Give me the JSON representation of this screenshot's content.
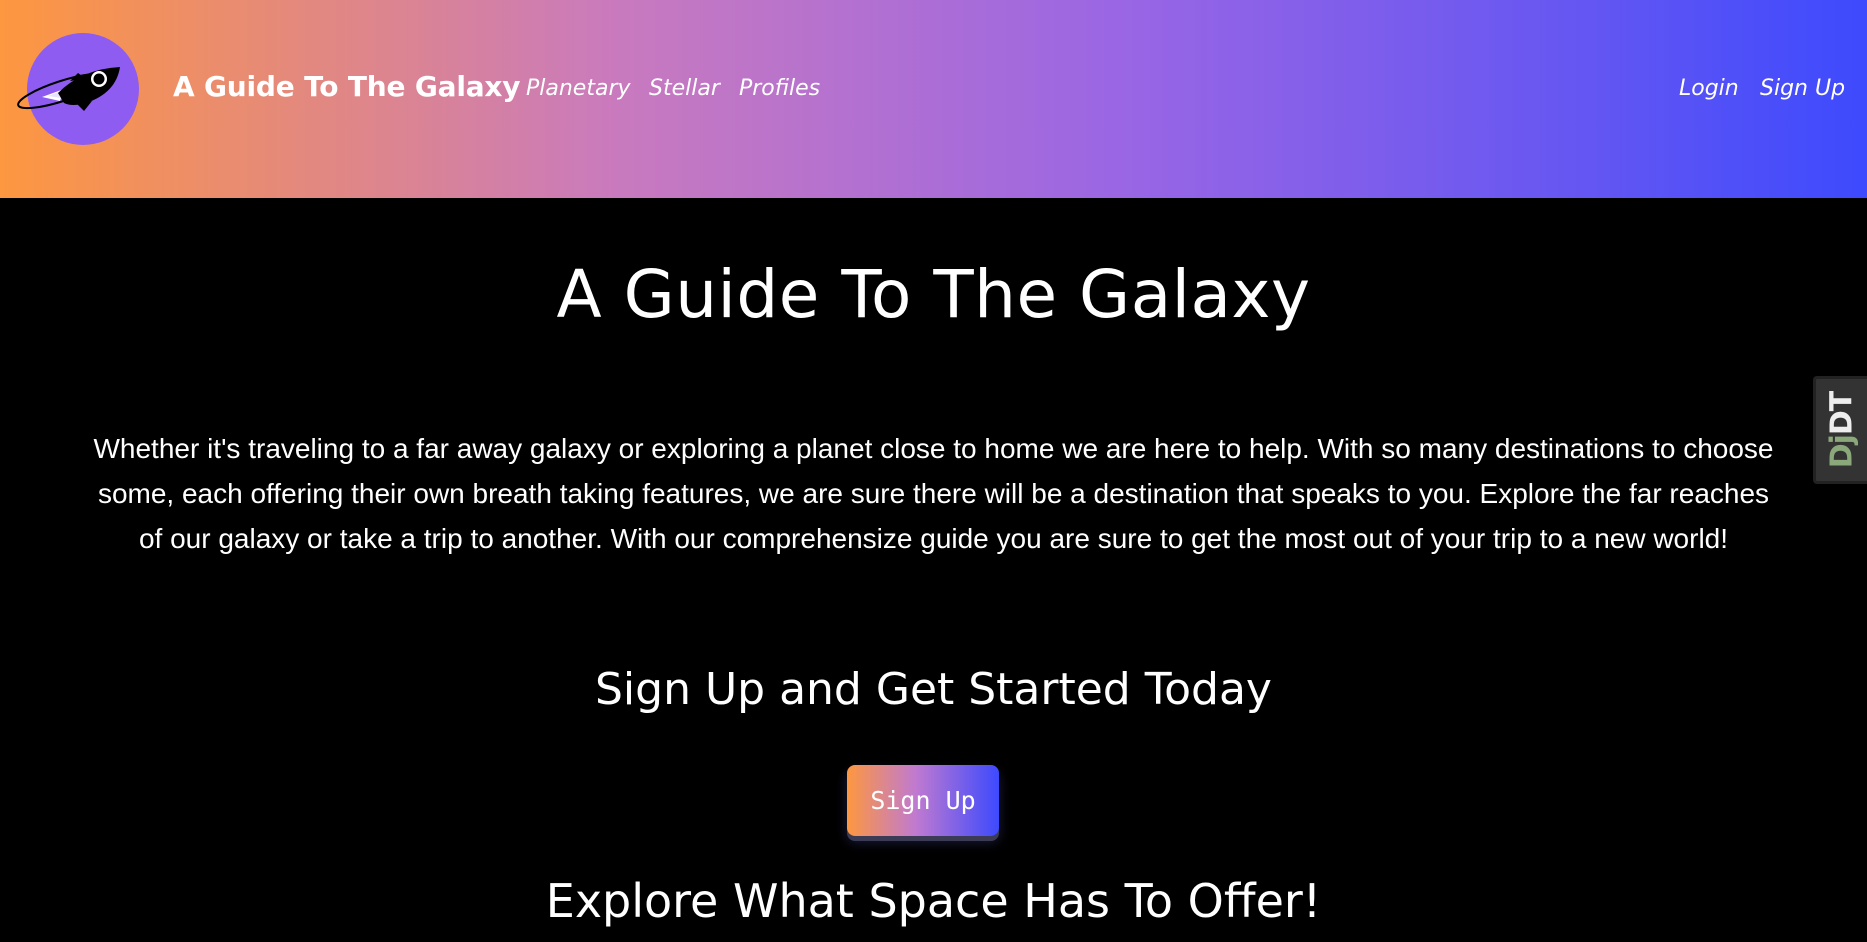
{
  "navbar": {
    "logo_icon": "rocket-icon",
    "brand": "A Guide To The Galaxy",
    "links": {
      "planetary": "Planetary",
      "stellar": "Stellar",
      "profiles": "Profiles"
    },
    "auth": {
      "login": "Login",
      "signup": "Sign Up"
    },
    "gradient_colors": [
      "#fd9740",
      "#c97abe",
      "#9a66e4",
      "#3d4afd"
    ]
  },
  "main": {
    "title": "A Guide To The Galaxy",
    "intro": "Whether it's traveling to a far away galaxy or exploring a planet close to home we are here to help. With so many destinations to choose some, each offering their own breath taking features, we are sure there will be a destination that speaks to you. Explore the far reaches of our galaxy or take a trip to another. With our comprehensize guide you are sure to get the most out of your trip to a new world!",
    "cta_heading": "Sign Up and Get Started Today",
    "cta_button": "Sign Up",
    "explore_heading": "Explore What Space Has To Offer!"
  },
  "debug_toolbar": {
    "handle_dj": "Dj",
    "handle_dt": "DT"
  }
}
